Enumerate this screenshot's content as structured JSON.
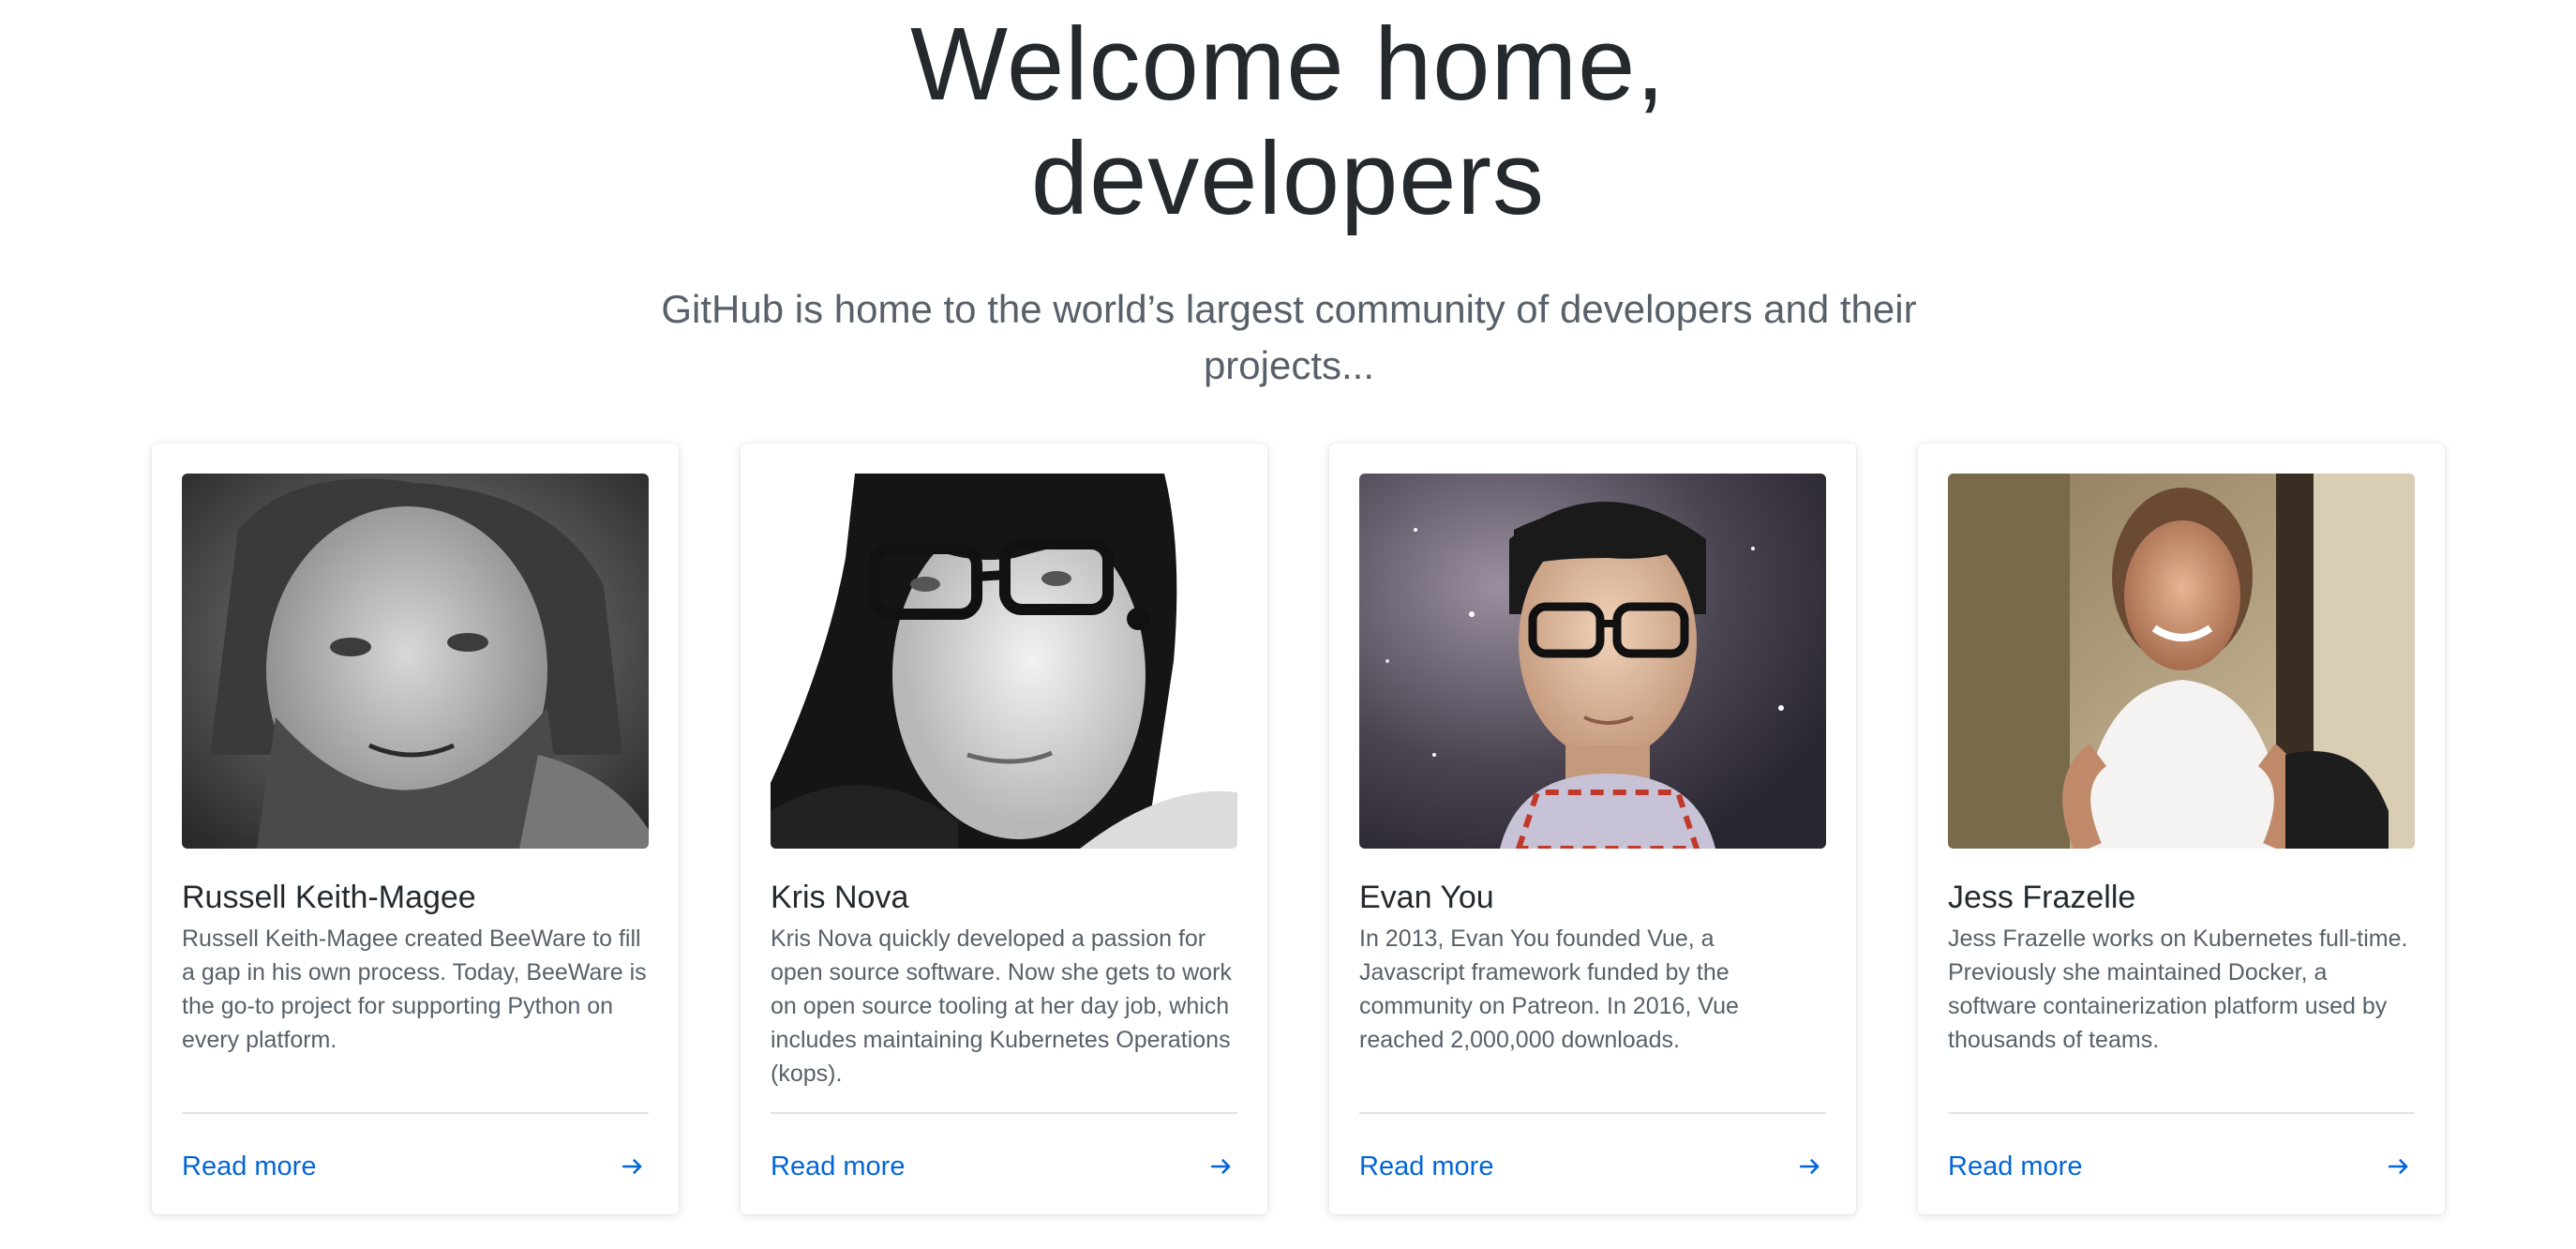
{
  "hero": {
    "title_line1": "Welcome home,",
    "title_line2": "developers",
    "subtitle": "GitHub is home to the world’s largest community of developers and their projects..."
  },
  "cards": [
    {
      "name": "Russell Keith-Magee",
      "bio": "Russell Keith-Magee created BeeWare to fill a gap in his own process. Today, BeeWare is the go-to project for supporting Python on every platform.",
      "link_label": "Read more",
      "photo": "portrait-grayscale-bearded-man"
    },
    {
      "name": "Kris Nova",
      "bio": "Kris Nova quickly developed a passion for open source software. Now she gets to work on open source tooling at her day job, which includes maintaining Kubernetes Operations (kops).",
      "link_label": "Read more",
      "photo": "portrait-grayscale-woman-glasses"
    },
    {
      "name": "Evan You",
      "bio": "In 2013, Evan You founded Vue, a Javascript framework funded by the community on Patreon. In 2016, Vue reached 2,000,000 downloads.",
      "link_label": "Read more",
      "photo": "portrait-man-glasses-galaxy-background"
    },
    {
      "name": "Jess Frazelle",
      "bio": "Jess Frazelle works on Kubernetes full-time. Previously she maintained Docker, a software containerization platform used by thousands of teams.",
      "link_label": "Read more",
      "photo": "portrait-smiling-woman-white-shirt"
    }
  ],
  "colors": {
    "title": "#24292e",
    "muted": "#586069",
    "link": "#0366d6",
    "divider": "#e1e4e8"
  }
}
